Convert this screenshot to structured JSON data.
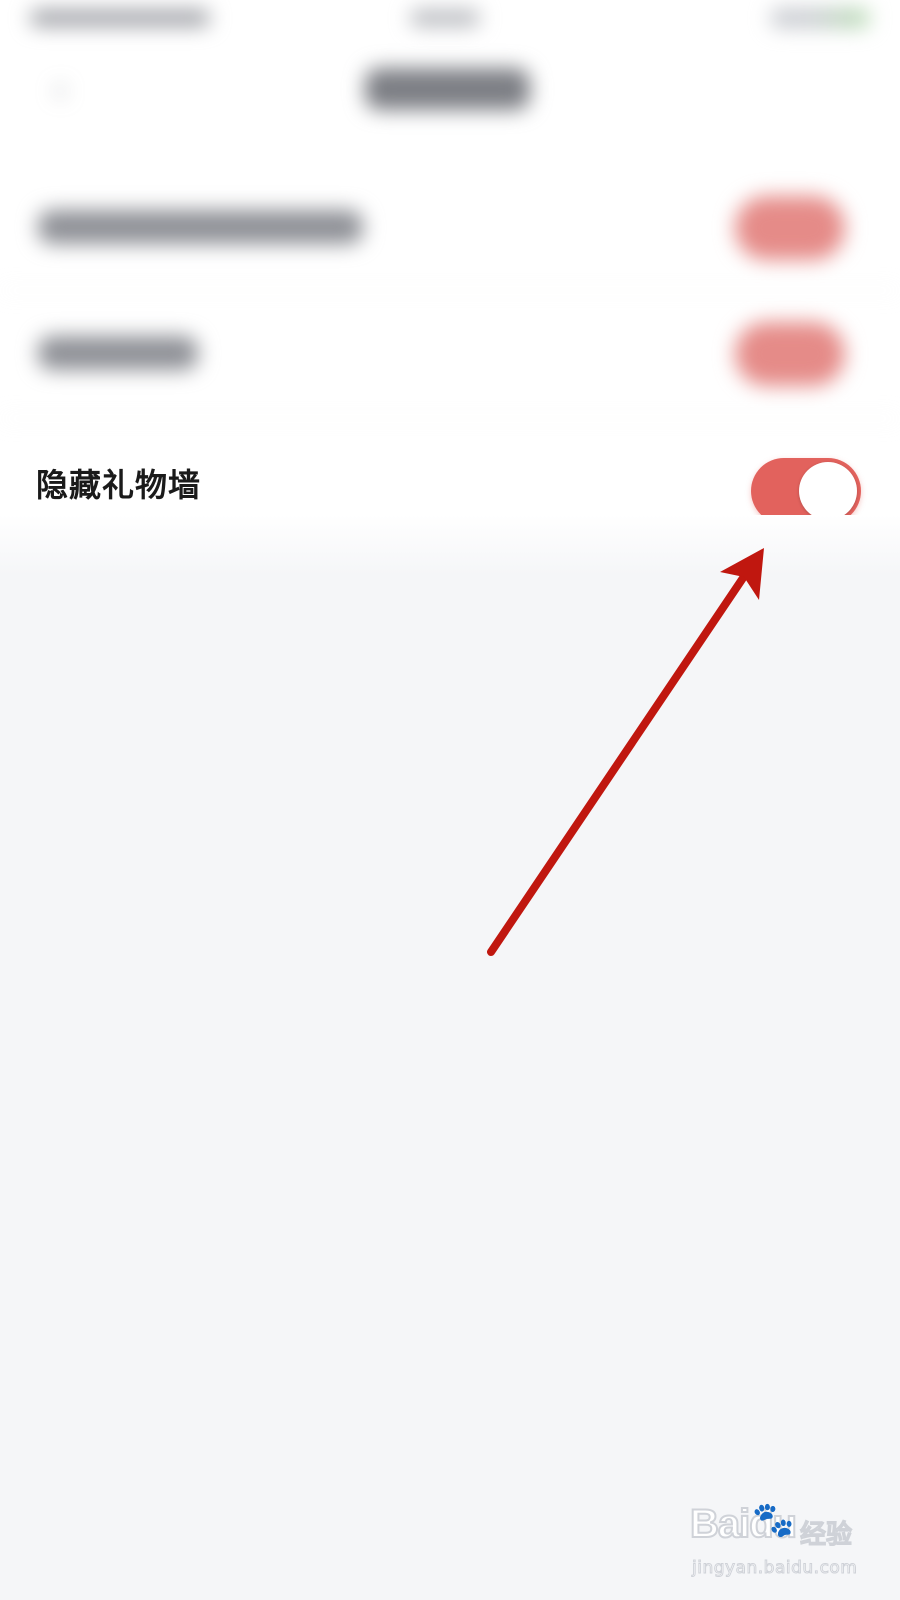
{
  "setting": {
    "label": "隐藏礼物墙",
    "enabled": true
  },
  "blurred_rows": [
    {
      "label_hidden": true,
      "enabled": true
    },
    {
      "label_hidden": true,
      "enabled": true
    }
  ],
  "header": {
    "back_icon": "chevron-left-icon"
  },
  "colors": {
    "accent": "#e2625d",
    "arrow": "#c0170f",
    "background": "#f5f6f8",
    "panel": "#ffffff"
  },
  "watermark": {
    "logo": "Baidu",
    "paw": "du",
    "brand_cn": "经验",
    "url": "jingyan.baidu.com"
  }
}
